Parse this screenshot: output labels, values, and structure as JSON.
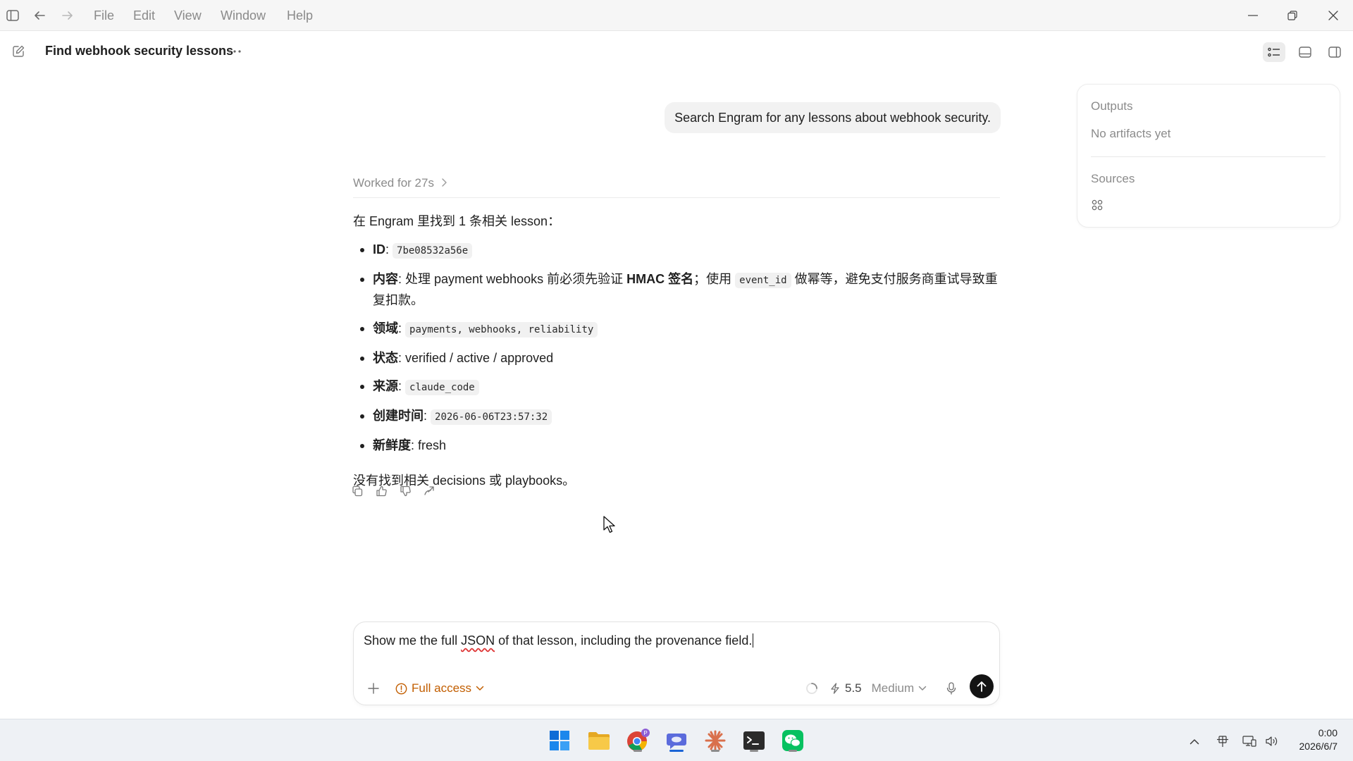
{
  "menubar": {
    "items": [
      "File",
      "Edit",
      "View",
      "Window",
      "Help"
    ]
  },
  "thread": {
    "title": "Find webhook security lessons"
  },
  "user_message": "Search Engram for any lessons about webhook security.",
  "worked": "Worked for 27s",
  "answer": {
    "intro": "在 Engram 里找到 1 条相关 lesson：",
    "id_label": "ID",
    "id_value": "7be08532a56e",
    "content_label": "内容",
    "content_part1": "处理 payment webhooks 前必须先验证 ",
    "content_bold": "HMAC 签名",
    "content_part2": "；使用 ",
    "content_code": "event_id",
    "content_part3": " 做幂等，避免支付服务商重试导致重复扣款。",
    "domain_label": "领域",
    "domain_value": "payments, webhooks, reliability",
    "status_label": "状态",
    "status_value": "verified / active / approved",
    "source_label": "来源",
    "source_value": "claude_code",
    "created_label": "创建时间",
    "created_value": "2026-06-06T23:57:32",
    "fresh_label": "新鲜度",
    "fresh_value": "fresh",
    "outro": "没有找到相关 decisions 或 playbooks。"
  },
  "side_panel": {
    "outputs_heading": "Outputs",
    "outputs_empty": "No artifacts yet",
    "sources_heading": "Sources"
  },
  "composer": {
    "text_before": "Show me the full ",
    "text_misspelled": "JSON",
    "text_after": " of that lesson, including the provenance field.",
    "access_label": "Full access",
    "model_version": "5.5",
    "model_effort": "Medium"
  },
  "clock": {
    "time": "0:00",
    "date": "2026/6/7"
  },
  "colors": {
    "accent_access": "#c25e00",
    "send_button": "#141414",
    "taskbar_active": "#1a64d6"
  },
  "icons": [
    "sidebar-toggle-icon",
    "back-arrow-icon",
    "forward-arrow-icon",
    "new-chat-icon",
    "more-icon",
    "copy-icon",
    "thumbs-up-icon",
    "thumbs-down-icon",
    "share-icon",
    "sources-app-icon",
    "plus-icon",
    "warning-circle-icon",
    "spinner-icon",
    "bolt-icon",
    "microphone-icon",
    "send-arrow-icon"
  ]
}
